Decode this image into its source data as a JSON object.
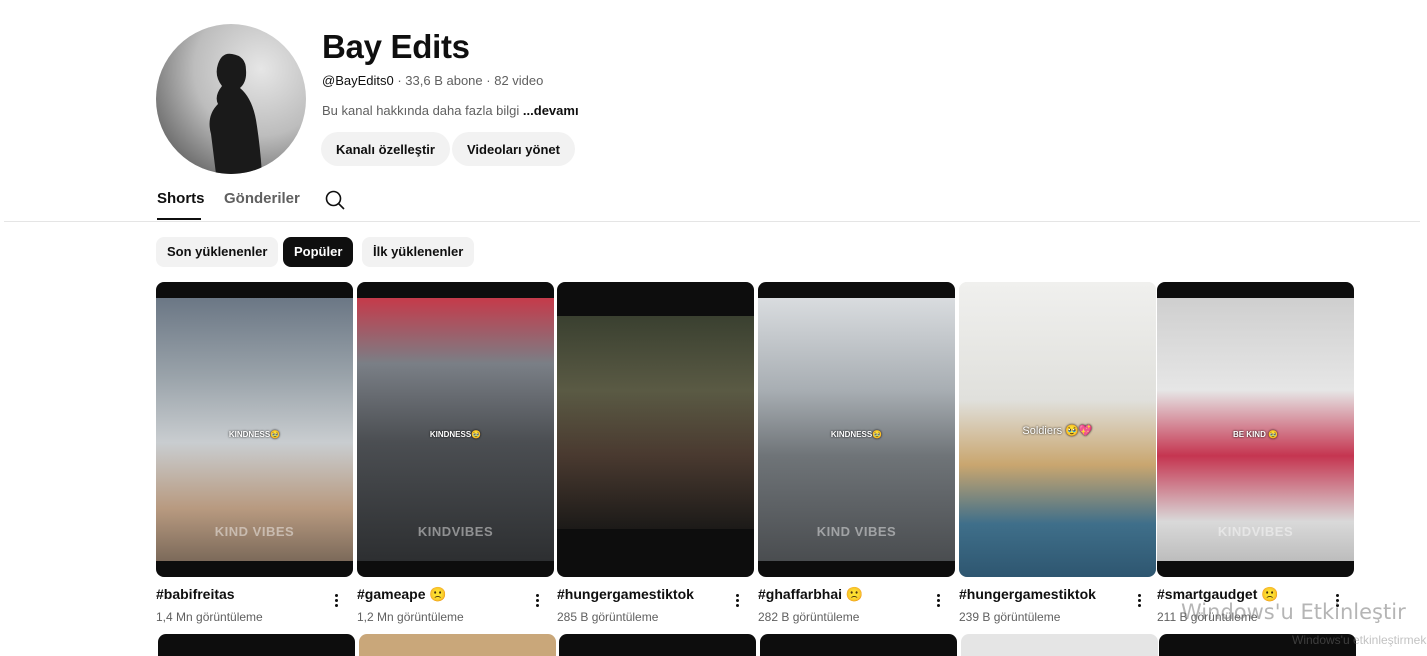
{
  "channel": {
    "name": "Bay Edits",
    "handle": "@BayEdits0",
    "sep1": " · ",
    "subscribers": "33,6 B abone",
    "sep2": " · ",
    "video_count": "82 video",
    "about": "Bu kanal hakkında daha fazla bilgi ",
    "more": "...devamı"
  },
  "actions": {
    "customize": "Kanalı özelleştir",
    "manage": "Videoları yönet"
  },
  "tabs": [
    {
      "label": "Shorts",
      "active": true
    },
    {
      "label": "Gönderiler",
      "active": false
    }
  ],
  "chips": [
    {
      "label": "Son yüklenenler",
      "selected": false
    },
    {
      "label": "Popüler",
      "selected": true
    },
    {
      "label": "İlk yüklenenler",
      "selected": false
    }
  ],
  "shorts": [
    {
      "title": "#babifreitas",
      "views": "1,4 Mn görüntüleme",
      "overlay": "KINDNESS🥹",
      "watermark": "KIND VIBES"
    },
    {
      "title": "#gameape 🙁",
      "views": "1,2 Mn görüntüleme",
      "overlay": "KINDNESS🥹",
      "watermark": "KINDVIBES"
    },
    {
      "title": "#hungergamestiktok",
      "views": "285 B görüntüleme",
      "overlay": "",
      "watermark": ""
    },
    {
      "title": "#ghaffarbhai 🙁",
      "views": "282 B görüntüleme",
      "overlay": "KINDNESS🥹",
      "watermark": "KIND VIBES"
    },
    {
      "title": "#hungergamestiktok",
      "views": "239 B görüntüleme",
      "overlay": "Soldiers 🥹💖",
      "watermark": ""
    },
    {
      "title": "#smartgaudget 🙁",
      "views": "211 B görüntüleme",
      "overlay": "BE KIND 🥹",
      "watermark": "KINDVIBES"
    }
  ],
  "system": {
    "activate_windows": "Windows'u Etkinleştir",
    "activate_sub": "Windows'u etkinleştirmek için"
  }
}
